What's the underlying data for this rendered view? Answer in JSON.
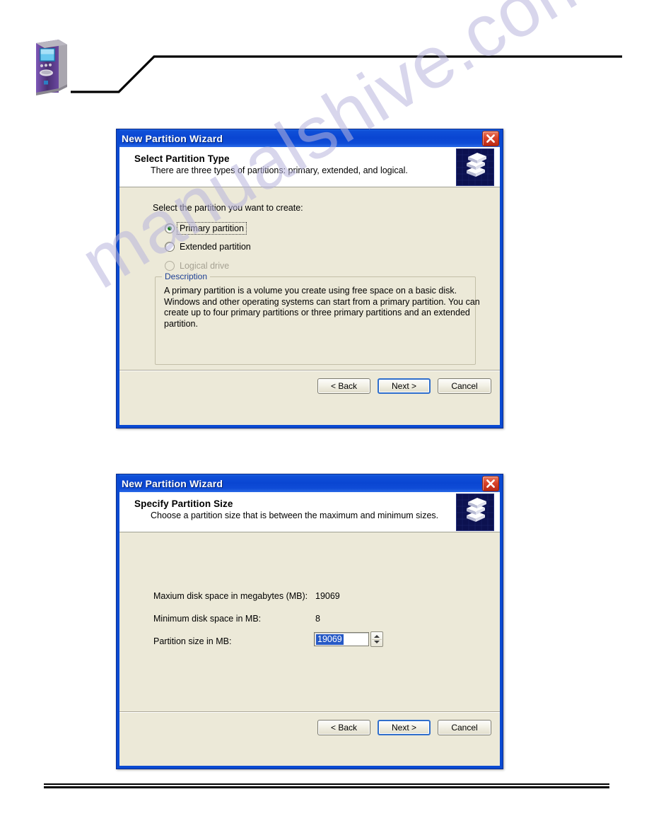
{
  "page": {
    "header_icon": "computer-tower-icon",
    "watermark": "manualshive.com",
    "watermark_color": "#b9b5dd"
  },
  "theme": {
    "titlebar_blue": "#0a46d2",
    "dialog_face": "#ece9d8",
    "close_red": "#d9432a",
    "legend_blue": "#1c3f94",
    "radio_green": "#1b7a1b",
    "selection_blue": "#2659c6"
  },
  "dialogs": [
    {
      "title": "New Partition Wizard",
      "close_label": "×",
      "icon": "stacked-disks-icon",
      "heading": "Select Partition Type",
      "subheading": "There are three types of partitions: primary, extended, and logical.",
      "prompt": "Select the partition you want to create:",
      "options": [
        {
          "label": "Primary partition",
          "mnemonic": "P",
          "selected": true,
          "disabled": false,
          "focused": true
        },
        {
          "label": "Extended partition",
          "mnemonic": "E",
          "selected": false,
          "disabled": false,
          "focused": false
        },
        {
          "label": "Logical drive",
          "mnemonic": "L",
          "selected": false,
          "disabled": true,
          "focused": false
        }
      ],
      "description": {
        "legend": "Description",
        "lines": [
          "A primary partition is a volume you create using free space on a basic disk.",
          "Windows and other operating systems can start from a primary partition. You can",
          "create up to four primary partitions or three primary partitions and an extended",
          "partition."
        ]
      },
      "buttons": {
        "back": "< Back",
        "next": "Next >",
        "cancel": "Cancel",
        "default": "next"
      }
    },
    {
      "title": "New Partition Wizard",
      "close_label": "×",
      "icon": "stacked-disks-icon",
      "heading": "Specify Partition Size",
      "subheading": "Choose a partition size that is between the maximum and minimum sizes.",
      "fields": [
        {
          "label": "Maxium disk space in megabytes (MB):",
          "value": "19069",
          "type": "readonly"
        },
        {
          "label": "Minimum disk space in MB:",
          "value": "8",
          "type": "readonly"
        },
        {
          "label": "Partition size in MB:",
          "value": "19069",
          "type": "spinner",
          "mnemonic": "P",
          "selected_text": true
        }
      ],
      "buttons": {
        "back": "< Back",
        "next": "Next >",
        "cancel": "Cancel",
        "default": "next"
      }
    }
  ]
}
